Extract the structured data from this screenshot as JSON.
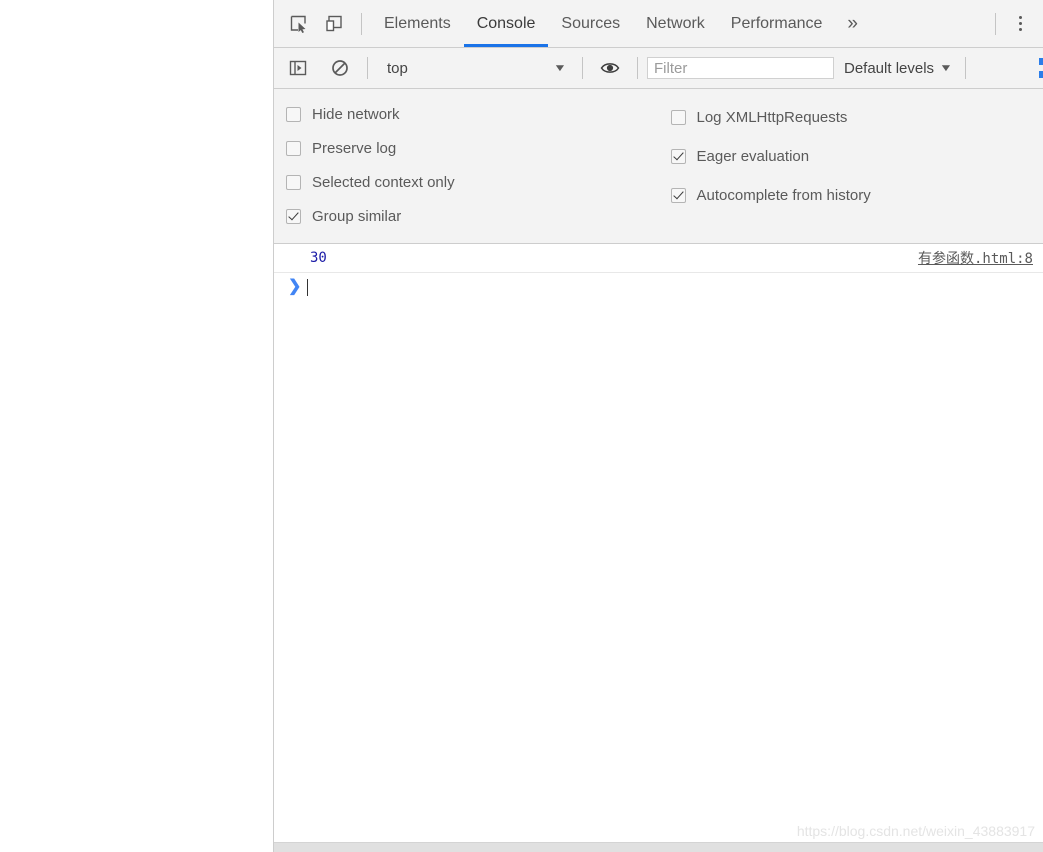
{
  "devtools": {
    "main_tabs": {
      "inspect_icon": "inspect-element-icon",
      "device_icon": "device-toolbar-icon",
      "items": [
        {
          "label": "Elements",
          "active": false
        },
        {
          "label": "Console",
          "active": true
        },
        {
          "label": "Sources",
          "active": false
        },
        {
          "label": "Network",
          "active": false
        },
        {
          "label": "Performance",
          "active": false
        }
      ],
      "more_label": "»",
      "menu_icon": "kebab-menu-icon"
    },
    "console_toolbar": {
      "sidebar_icon": "show-console-sidebar-icon",
      "clear_icon": "clear-console-icon",
      "context": "top",
      "context_caret": "▼",
      "eye_icon": "create-live-expression-icon",
      "filter_placeholder": "Filter",
      "filter_value": "",
      "levels_label": "Default levels",
      "levels_caret": "▼"
    },
    "settings": {
      "left_column": [
        {
          "label": "Hide network",
          "checked": false
        },
        {
          "label": "Preserve log",
          "checked": false
        },
        {
          "label": "Selected context only",
          "checked": false
        },
        {
          "label": "Group similar",
          "checked": true
        }
      ],
      "right_column": [
        {
          "label": "Log XMLHttpRequests",
          "checked": false
        },
        {
          "label": "Eager evaluation",
          "checked": true
        },
        {
          "label": "Autocomplete from history",
          "checked": true
        }
      ]
    },
    "console_output": {
      "entries": [
        {
          "text": "30",
          "source": "有参函数.html:8"
        }
      ],
      "prompt_chevron": "❯"
    },
    "watermark": "https://blog.csdn.net/weixin_43883917"
  },
  "colors": {
    "accent": "#1a73e8",
    "toolbar_bg": "#f3f3f3",
    "log_value": "#1a1aa6",
    "prompt": "#4285f4"
  }
}
